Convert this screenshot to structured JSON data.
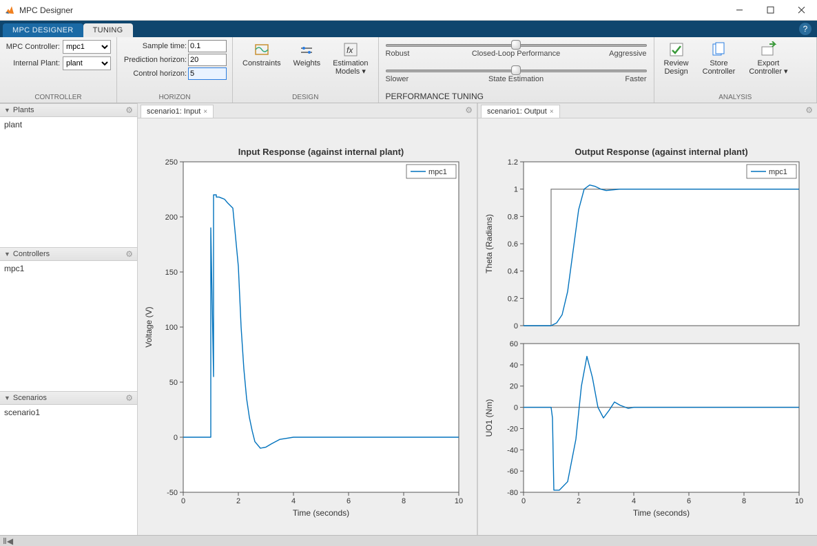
{
  "window": {
    "title": "MPC Designer"
  },
  "ribbon": {
    "tabs": [
      "MPC DESIGNER",
      "TUNING"
    ],
    "active": 1,
    "help": "?"
  },
  "controller_group": {
    "label": "CONTROLLER",
    "mpc_label": "MPC Controller:",
    "mpc_value": "mpc1",
    "plant_label": "Internal Plant:",
    "plant_value": "plant"
  },
  "horizon_group": {
    "label": "HORIZON",
    "sample_label": "Sample time:",
    "sample_value": "0.1",
    "pred_label": "Prediction horizon:",
    "pred_value": "20",
    "ctrl_label": "Control horizon:",
    "ctrl_value": "5"
  },
  "design_group": {
    "label": "DESIGN",
    "constraints": "Constraints",
    "weights": "Weights",
    "models": "Estimation\nModels ▾"
  },
  "perf_group": {
    "label": "PERFORMANCE TUNING",
    "row1": {
      "left": "Robust",
      "mid": "Closed-Loop Performance",
      "right": "Aggressive",
      "pos": 0.5
    },
    "row2": {
      "left": "Slower",
      "mid": "State Estimation",
      "right": "Faster",
      "pos": 0.5
    }
  },
  "analysis_group": {
    "label": "ANALYSIS",
    "review": "Review\nDesign",
    "store": "Store\nController",
    "export": "Export\nController ▾"
  },
  "side": {
    "plants": {
      "title": "Plants",
      "items": [
        "plant"
      ]
    },
    "controllers": {
      "title": "Controllers",
      "items": [
        "mpc1"
      ]
    },
    "scenarios": {
      "title": "Scenarios",
      "items": [
        "scenario1"
      ]
    }
  },
  "tabs": {
    "input_tab": "scenario1: Input",
    "output_tab": "scenario1: Output",
    "close_x": "×"
  },
  "chart_data": [
    {
      "type": "line",
      "title": "Input Response (against internal plant)",
      "xlabel": "Time (seconds)",
      "ylabel": "Voltage (V)",
      "xlim": [
        0,
        10
      ],
      "ylim": [
        -50,
        250
      ],
      "xticks": [
        0,
        2,
        4,
        6,
        8,
        10
      ],
      "yticks": [
        -50,
        0,
        50,
        100,
        150,
        200,
        250
      ],
      "legend": [
        "mpc1"
      ],
      "series": [
        {
          "name": "mpc1",
          "color": "#0072BD",
          "x": [
            0,
            1.0,
            1.0,
            1.1,
            1.1,
            1.2,
            1.2,
            1.3,
            1.4,
            1.5,
            1.6,
            1.8,
            2.0,
            2.1,
            2.2,
            2.3,
            2.4,
            2.5,
            2.6,
            2.8,
            3.0,
            3.2,
            3.5,
            4.0,
            5.0,
            6.0,
            8.0,
            10.0
          ],
          "y": [
            0,
            0,
            190,
            55,
            220,
            220,
            218,
            218,
            217,
            216,
            213,
            208,
            155,
            100,
            62,
            35,
            18,
            6,
            -4,
            -10,
            -9,
            -6,
            -2,
            0,
            0,
            0,
            0,
            0
          ]
        }
      ]
    },
    {
      "type": "line",
      "title": "Output Response (against internal plant)",
      "xlabel": "",
      "ylabel": "Theta (Radians)",
      "xlim": [
        0,
        10
      ],
      "ylim": [
        0,
        1.2
      ],
      "xticks": [],
      "yticks": [
        0,
        0.2,
        0.4,
        0.6,
        0.8,
        1,
        1.2
      ],
      "legend": [
        "mpc1"
      ],
      "series": [
        {
          "name": "ref",
          "color": "#888888",
          "x": [
            0,
            1,
            1,
            10
          ],
          "y": [
            0,
            0,
            1,
            1
          ]
        },
        {
          "name": "mpc1",
          "color": "#0072BD",
          "x": [
            0,
            1.0,
            1.2,
            1.4,
            1.6,
            1.8,
            2.0,
            2.2,
            2.4,
            2.6,
            2.8,
            3.0,
            3.5,
            4.0,
            5.0,
            10.0
          ],
          "y": [
            0,
            0,
            0.02,
            0.08,
            0.25,
            0.55,
            0.85,
            1.0,
            1.03,
            1.02,
            1.0,
            0.99,
            1.0,
            1.0,
            1.0,
            1.0
          ]
        }
      ]
    },
    {
      "type": "line",
      "title": "",
      "xlabel": "Time (seconds)",
      "ylabel": "UO1 (Nm)",
      "xlim": [
        0,
        10
      ],
      "ylim": [
        -80,
        60
      ],
      "xticks": [
        0,
        2,
        4,
        6,
        8,
        10
      ],
      "yticks": [
        -80,
        -60,
        -40,
        -20,
        0,
        20,
        40,
        60
      ],
      "legend": null,
      "series": [
        {
          "name": "ref",
          "color": "#888888",
          "x": [
            0,
            10
          ],
          "y": [
            0,
            0
          ]
        },
        {
          "name": "mpc1",
          "color": "#0072BD",
          "x": [
            0,
            1.0,
            1.05,
            1.1,
            1.3,
            1.6,
            1.9,
            2.1,
            2.3,
            2.5,
            2.7,
            2.9,
            3.1,
            3.3,
            3.5,
            3.8,
            4.0,
            5.0,
            10.0
          ],
          "y": [
            0,
            0,
            -10,
            -78,
            -78,
            -70,
            -30,
            20,
            48,
            28,
            0,
            -10,
            -3,
            5,
            2,
            -1,
            0,
            0,
            0
          ]
        }
      ]
    }
  ]
}
